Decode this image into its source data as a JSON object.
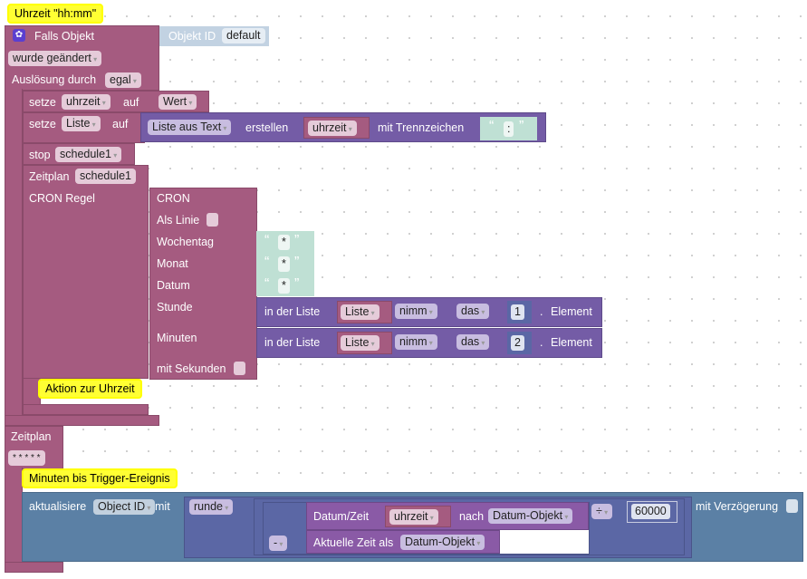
{
  "comments": {
    "c1": "Uhrzeit \"hh:mm\"",
    "c2": "Aktion zur Uhrzeit",
    "c3": "Minuten bis Trigger-Ereignis"
  },
  "trigger": {
    "title": "Falls Objekt",
    "object_id_label": "Objekt ID",
    "object_id_value": "default",
    "event": "wurde geändert",
    "ausloesung_label": "Auslösung durch",
    "ausloesung_value": "egal"
  },
  "set1": {
    "label": "setze",
    "var": "uhrzeit",
    "auf": "auf",
    "value": "Wert"
  },
  "set2": {
    "label": "setze",
    "var": "Liste",
    "auf": "auf",
    "func": "Liste aus Text",
    "erstellen": "erstellen",
    "src": "uhrzeit",
    "sep_label": "mit Trennzeichen",
    "sep": ":"
  },
  "stop": {
    "label": "stop",
    "value": "schedule1"
  },
  "schedule": {
    "label": "Zeitplan",
    "name": "schedule1",
    "cron_label": "CRON Regel"
  },
  "cron": {
    "title": "CRON",
    "als_linie": "Als Linie",
    "wochentag": "Wochentag",
    "monat": "Monat",
    "datum": "Datum",
    "stunde": "Stunde",
    "minuten": "Minuten",
    "sekunden": "mit Sekunden",
    "star": "*",
    "quote_open": "“",
    "quote_close": "”"
  },
  "list_get": [
    {
      "in": "in der Liste",
      "list": "Liste",
      "mode": "nimm",
      "das": "das",
      "index": "1",
      "element": "Element"
    },
    {
      "in": "in der Liste",
      "list": "Liste",
      "mode": "nimm",
      "das": "das",
      "index": "2",
      "element": "Element"
    }
  ],
  "schedule2": {
    "label": "Zeitplan",
    "value": "* * * * *"
  },
  "update": {
    "label": "aktualisiere",
    "object": "Object ID",
    "mit": "mit",
    "round": "runde",
    "datum_zeit": "Datum/Zeit",
    "var": "uhrzeit",
    "nach": "nach",
    "format": "Datum-Objekt",
    "minus": "-",
    "aktuelle": "Aktuelle Zeit als",
    "format2": "Datum-Objekt",
    "div": "÷",
    "divisor": "60000",
    "delay": "mit Verzögerung"
  },
  "colors": {
    "event": "#a55b80",
    "list": "#745ca6",
    "io": "#5b80a5",
    "math": "#5b67a5",
    "text": "#bfe0d4",
    "comment": "#ffff33"
  }
}
